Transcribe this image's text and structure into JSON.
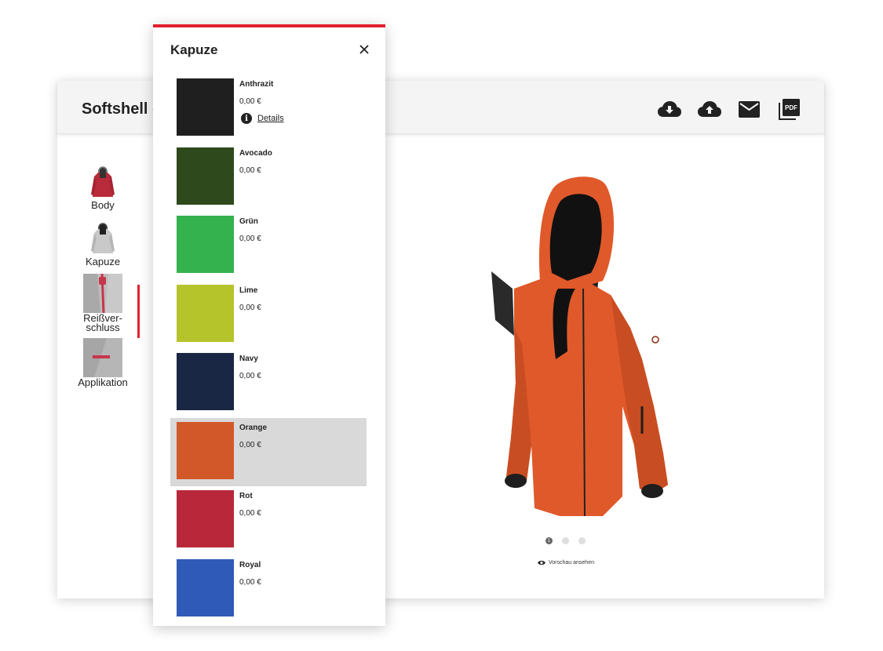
{
  "header": {
    "title": "Softshell damen Jacke"
  },
  "toolbar": {
    "icons": [
      "cloud-download-icon",
      "cloud-upload-icon",
      "mail-icon",
      "pdf-icon"
    ]
  },
  "tabs": [
    {
      "label": "Body",
      "icon": "jacket-thumbnail"
    },
    {
      "label": "Kapuze",
      "icon": "hood-thumbnail"
    },
    {
      "label": "Reißver-\nschluss",
      "icon": "zipper-thumbnail"
    },
    {
      "label": "Applikation",
      "icon": "application-thumbnail"
    }
  ],
  "preview": {
    "link_label": "Vorschau ansehen",
    "dots": [
      "1",
      "",
      ""
    ],
    "jacket_color": "#e0592a"
  },
  "panel": {
    "title": "Kapuze",
    "details_label": "Details",
    "options": [
      {
        "name": "Anthrazit",
        "price": "0,00 €",
        "color": "#1f1f1f"
      },
      {
        "name": "Avocado",
        "price": "0,00 €",
        "color": "#2e4a1c"
      },
      {
        "name": "Grün",
        "price": "0,00 €",
        "color": "#33b24e"
      },
      {
        "name": "Lime",
        "price": "0,00 €",
        "color": "#b6c42c"
      },
      {
        "name": "Navy",
        "price": "0,00 €",
        "color": "#1a2744"
      },
      {
        "name": "Orange",
        "price": "0,00 €",
        "color": "#d2582a"
      },
      {
        "name": "Rot",
        "price": "0,00 €",
        "color": "#b8283a"
      },
      {
        "name": "Royal",
        "price": "0,00 €",
        "color": "#2f5ab8"
      }
    ],
    "selected": "Orange"
  },
  "colors": {
    "accent": "#e3202f",
    "selected_row": "#d9d9d9"
  }
}
